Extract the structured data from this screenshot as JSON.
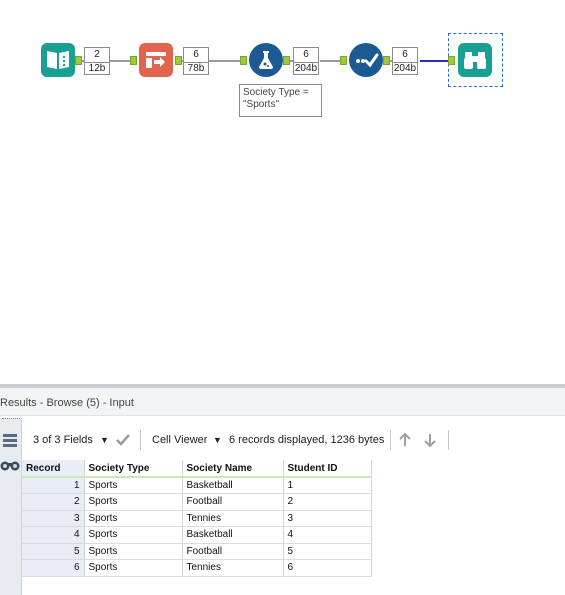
{
  "workflow": {
    "connections": [
      {
        "records": "2",
        "size": "12b"
      },
      {
        "records": "6",
        "size": "78b"
      },
      {
        "records": "6",
        "size": "204b"
      },
      {
        "records": "6",
        "size": "204b"
      }
    ],
    "filter_annotation": "Society Type = \"Sports\"",
    "tools": [
      "input-data-icon",
      "text-to-columns-icon",
      "filter-icon",
      "data-cleansing-icon",
      "browse-icon"
    ],
    "colors": {
      "input": "#18a093",
      "parse": "#e2644f",
      "filter": "#1c5a93",
      "cleanse": "#1c5a93",
      "browse": "#18a093"
    }
  },
  "results": {
    "header_title": "Results - Browse (5) - Input",
    "toolbar": {
      "fields_label": "3 of 3 Fields",
      "viewer_label": "Cell Viewer",
      "summary": "6 records displayed, 1236 bytes"
    },
    "columns": [
      "Record",
      "Society Type",
      "Society Name",
      "Student ID"
    ],
    "rows": [
      [
        "1",
        "Sports",
        "Basketball",
        "1"
      ],
      [
        "2",
        "Sports",
        "Football",
        "2"
      ],
      [
        "3",
        "Sports",
        "Tennies",
        "3"
      ],
      [
        "4",
        "Sports",
        "Basketball",
        "4"
      ],
      [
        "5",
        "Sports",
        "Football",
        "5"
      ],
      [
        "6",
        "Sports",
        "Tennies",
        "6"
      ]
    ]
  }
}
